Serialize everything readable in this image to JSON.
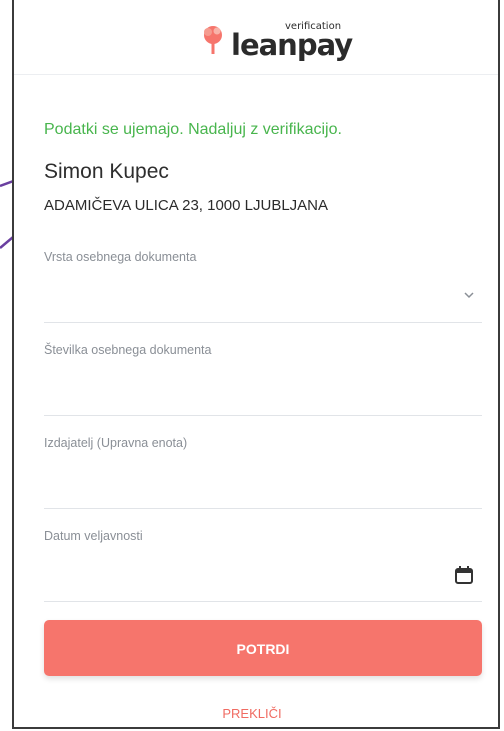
{
  "header": {
    "logo_text": "leanpay",
    "logo_sup": "verification"
  },
  "status": {
    "success_message": "Podatki se ujemajo. Nadaljuj z verifikacijo."
  },
  "person": {
    "name": "Simon Kupec",
    "address": "ADAMIČEVA ULICA 23, 1000 LJUBLJANA"
  },
  "form": {
    "fields": [
      {
        "label": "Vrsta osebnega dokumenta",
        "value": "",
        "icon": "chevron-down-icon"
      },
      {
        "label": "Številka osebnega dokumenta",
        "value": ""
      },
      {
        "label": "Izdajatelj (Upravna enota)",
        "value": ""
      },
      {
        "label": "Datum veljavnosti",
        "value": "",
        "icon": "calendar-icon"
      }
    ],
    "submit_label": "POTRDI",
    "cancel_label": "PREKLIČI"
  },
  "colors": {
    "accent": "#f6756c",
    "success": "#48b54d",
    "annotation_arrow": "#6a3fa0"
  }
}
